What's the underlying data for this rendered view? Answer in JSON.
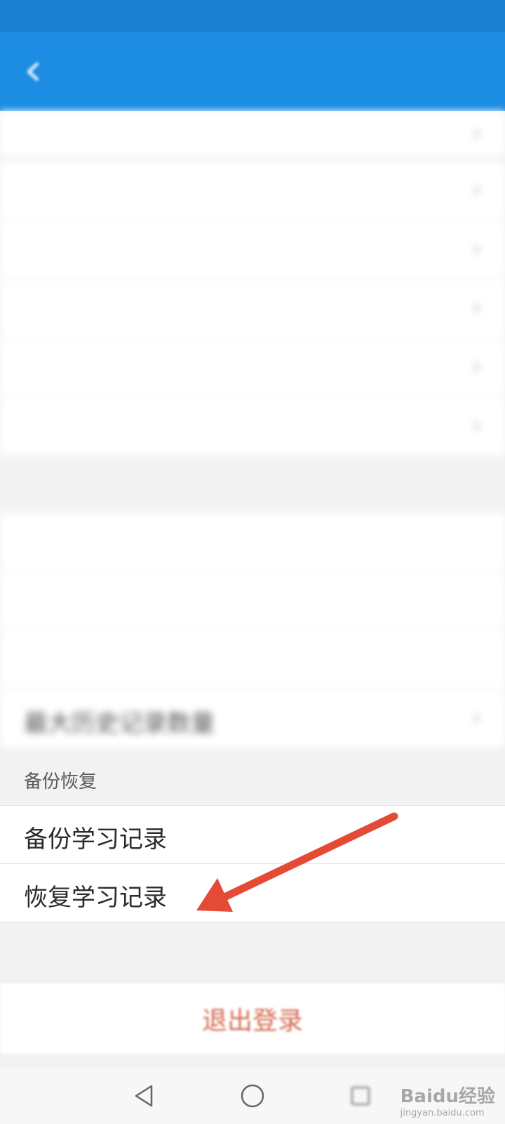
{
  "status_bar": {
    "left_text": "",
    "right_text": ""
  },
  "app_bar": {
    "back_icon": "back-arrow-icon"
  },
  "settings_rows_top": [
    {
      "label": "",
      "value": "",
      "has_chevron": true
    },
    {
      "label": "",
      "value": "",
      "has_chevron": true
    },
    {
      "label": "",
      "value": "",
      "has_chevron": true
    },
    {
      "label": "",
      "value": "",
      "has_chevron": true
    },
    {
      "label": "",
      "value": "",
      "has_chevron": true
    },
    {
      "label": "",
      "value": "",
      "has_chevron": true
    }
  ],
  "history_section": {
    "header": "",
    "rows": [
      {
        "label": ""
      },
      {
        "label": ""
      },
      {
        "label": ""
      },
      {
        "label": "最大历史记录数量",
        "value": "",
        "has_chevron": true
      }
    ]
  },
  "backup_section": {
    "header": "备份恢复",
    "rows": [
      {
        "label": "备份学习记录"
      },
      {
        "label": "恢复学习记录"
      }
    ]
  },
  "logout": {
    "label": "退出登录"
  },
  "nav_bar": {
    "back_icon": "nav-back-icon",
    "home_icon": "nav-home-icon",
    "recents_icon": "nav-recents-icon"
  },
  "watermark": {
    "text": "Baidu经验",
    "sub": "jingyan.baidu.com"
  },
  "colors": {
    "app_bar": "#1c8de3",
    "status_bar": "#1a80d1",
    "logout_text": "#d46a50",
    "annotation_arrow": "#e34b36"
  }
}
